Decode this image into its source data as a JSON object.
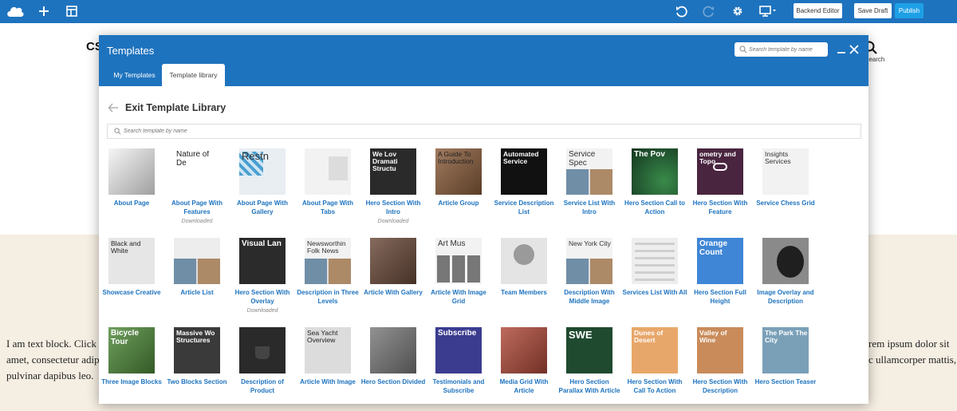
{
  "toolbar": {
    "logo_icon": "cloud-logo",
    "add_icon": "plus-icon",
    "layout_icon": "layout-icon",
    "undo_icon": "undo-icon",
    "redo_icon": "redo-icon",
    "settings_icon": "gear-icon",
    "device_icon": "desktop-icon",
    "backend_editor": "Backend Editor",
    "save_draft": "Save Draft",
    "publish": "Publish"
  },
  "background": {
    "logo_text": "CS",
    "search_label": "Search",
    "text_left": [
      "I am text block. Click e",
      "amet, consectetur adipis",
      "pulvinar dapibus leo."
    ],
    "text_right": [
      "rem ipsum dolor sit",
      "c ullamcorper mattis,",
      ""
    ]
  },
  "modal": {
    "title": "Templates",
    "search_placeholder": "Search template by name",
    "tabs": [
      {
        "label": "My Templates",
        "active": false
      },
      {
        "label": "Template library",
        "active": true
      }
    ],
    "library_title": "Exit Template Library",
    "library_search_placeholder": "Search template by name"
  },
  "templates": [
    {
      "label": "About Page",
      "thumb_text": "",
      "thumb_bg": "#f4f4f4",
      "thumb_fg": "#333333"
    },
    {
      "label": "About Page With Features",
      "thumb_text": "Nature of De",
      "thumb_bg": "#ffffff",
      "thumb_fg": "#222222",
      "status": "Downloaded"
    },
    {
      "label": "About Page With Gallery",
      "thumb_text": "Restn",
      "thumb_bg": "#e8eef2",
      "thumb_fg": "#333333"
    },
    {
      "label": "About Page With Tabs",
      "thumb_text": "",
      "thumb_bg": "#f2f2f2",
      "thumb_fg": "#333333"
    },
    {
      "label": "Hero Section With Intro",
      "thumb_text": "We Lov Dramati Structu",
      "thumb_bg": "#2a2a2a",
      "thumb_fg": "#ffffff",
      "status": "Downloaded"
    },
    {
      "label": "Article Group",
      "thumb_text": "A Guide To Introduction",
      "thumb_bg": "#8b5e3c",
      "thumb_fg": "#222222"
    },
    {
      "label": "Service Description List",
      "thumb_text": "Automated Service",
      "thumb_bg": "#111111",
      "thumb_fg": "#ffffff"
    },
    {
      "label": "Service List With Intro",
      "thumb_text": "Service Spec",
      "thumb_bg": "#f2f2f2",
      "thumb_fg": "#333333"
    },
    {
      "label": "Hero Section Call to Action",
      "thumb_text": "The Pov",
      "thumb_bg": "#1d5a3a",
      "thumb_fg": "#ffffff"
    },
    {
      "label": "Hero Section With Feature",
      "thumb_text": "ometry and Topo",
      "thumb_bg": "#4a2540",
      "thumb_fg": "#ffffff"
    },
    {
      "label": "Service Chess Grid",
      "thumb_text": "Insights Services",
      "thumb_bg": "#f2f2f2",
      "thumb_fg": "#333333"
    },
    {
      "label": "Showcase Creative",
      "thumb_text": "Black and White",
      "thumb_bg": "#e6e6e6",
      "thumb_fg": "#222222"
    },
    {
      "label": "Article List",
      "thumb_text": "",
      "thumb_bg": "#ededed",
      "thumb_fg": "#333333"
    },
    {
      "label": "Hero Section With Overlay",
      "thumb_text": "Visual Lan",
      "thumb_bg": "#2b2b2b",
      "thumb_fg": "#ffffff",
      "status": "Downloaded"
    },
    {
      "label": "Description in Three Levels",
      "thumb_text": "Newsworthin Folk News",
      "thumb_bg": "#f2f2f2",
      "thumb_fg": "#333333"
    },
    {
      "label": "Article With Gallery",
      "thumb_text": "",
      "thumb_bg": "#6b4a3a",
      "thumb_fg": "#ffffff"
    },
    {
      "label": "Article With Image Grid",
      "thumb_text": "Art Mus",
      "thumb_bg": "#f2f2f2",
      "thumb_fg": "#333333"
    },
    {
      "label": "Team Members",
      "thumb_text": "",
      "thumb_bg": "#e4e4e4",
      "thumb_fg": "#333333"
    },
    {
      "label": "Description With Middle Image",
      "thumb_text": "New York City",
      "thumb_bg": "#f2f2f2",
      "thumb_fg": "#333333"
    },
    {
      "label": "Services List With All",
      "thumb_text": "",
      "thumb_bg": "#eeeeee",
      "thumb_fg": "#333333"
    },
    {
      "label": "Hero Section Full Height",
      "thumb_text": "Orange Count",
      "thumb_bg": "#3f86d6",
      "thumb_fg": "#ffffff"
    },
    {
      "label": "Image Overlay and Description",
      "thumb_text": "",
      "thumb_bg": "#8a8a8a",
      "thumb_fg": "#ffffff"
    },
    {
      "label": "Three Image Blocks",
      "thumb_text": "Bicycle Tour",
      "thumb_bg": "#4f8a3a",
      "thumb_fg": "#ffffff"
    },
    {
      "label": "Two Blocks Section",
      "thumb_text": "Massive Wo Structures",
      "thumb_bg": "#3a3a3a",
      "thumb_fg": "#ffffff"
    },
    {
      "label": "Description of Product",
      "thumb_text": "",
      "thumb_bg": "#2a2a2a",
      "thumb_fg": "#ffffff"
    },
    {
      "label": "Article With Image",
      "thumb_text": "Sea Yacht Overview",
      "thumb_bg": "#dcdcdc",
      "thumb_fg": "#222222"
    },
    {
      "label": "Hero Section Divided",
      "thumb_text": "",
      "thumb_bg": "#7a7a7a",
      "thumb_fg": "#ffffff"
    },
    {
      "label": "Testimonials and Subscribe",
      "thumb_text": "Subscribe",
      "thumb_bg": "#3b3c8f",
      "thumb_fg": "#ffffff"
    },
    {
      "label": "Media Grid With Article",
      "thumb_text": "",
      "thumb_bg": "#b04a3a",
      "thumb_fg": "#ffffff"
    },
    {
      "label": "Hero Section Parallax With Article",
      "thumb_text": "SWE",
      "thumb_bg": "#1f4a2f",
      "thumb_fg": "#ffffff"
    },
    {
      "label": "Hero Section With Call To Action",
      "thumb_text": "Dunes of Desert",
      "thumb_bg": "#e8a76a",
      "thumb_fg": "#ffffff"
    },
    {
      "label": "Hero Section With Description",
      "thumb_text": "Valley of Wine",
      "thumb_bg": "#c98b5a",
      "thumb_fg": "#ffffff"
    },
    {
      "label": "Hero Section Teaser",
      "thumb_text": "The Park The City",
      "thumb_bg": "#7aa0b8",
      "thumb_fg": "#ffffff"
    }
  ],
  "colors": {
    "brand_blue": "#1e73be",
    "publish_blue": "#1ea0e6",
    "link_blue": "#1e73be",
    "page_band": "#f5eee2"
  }
}
